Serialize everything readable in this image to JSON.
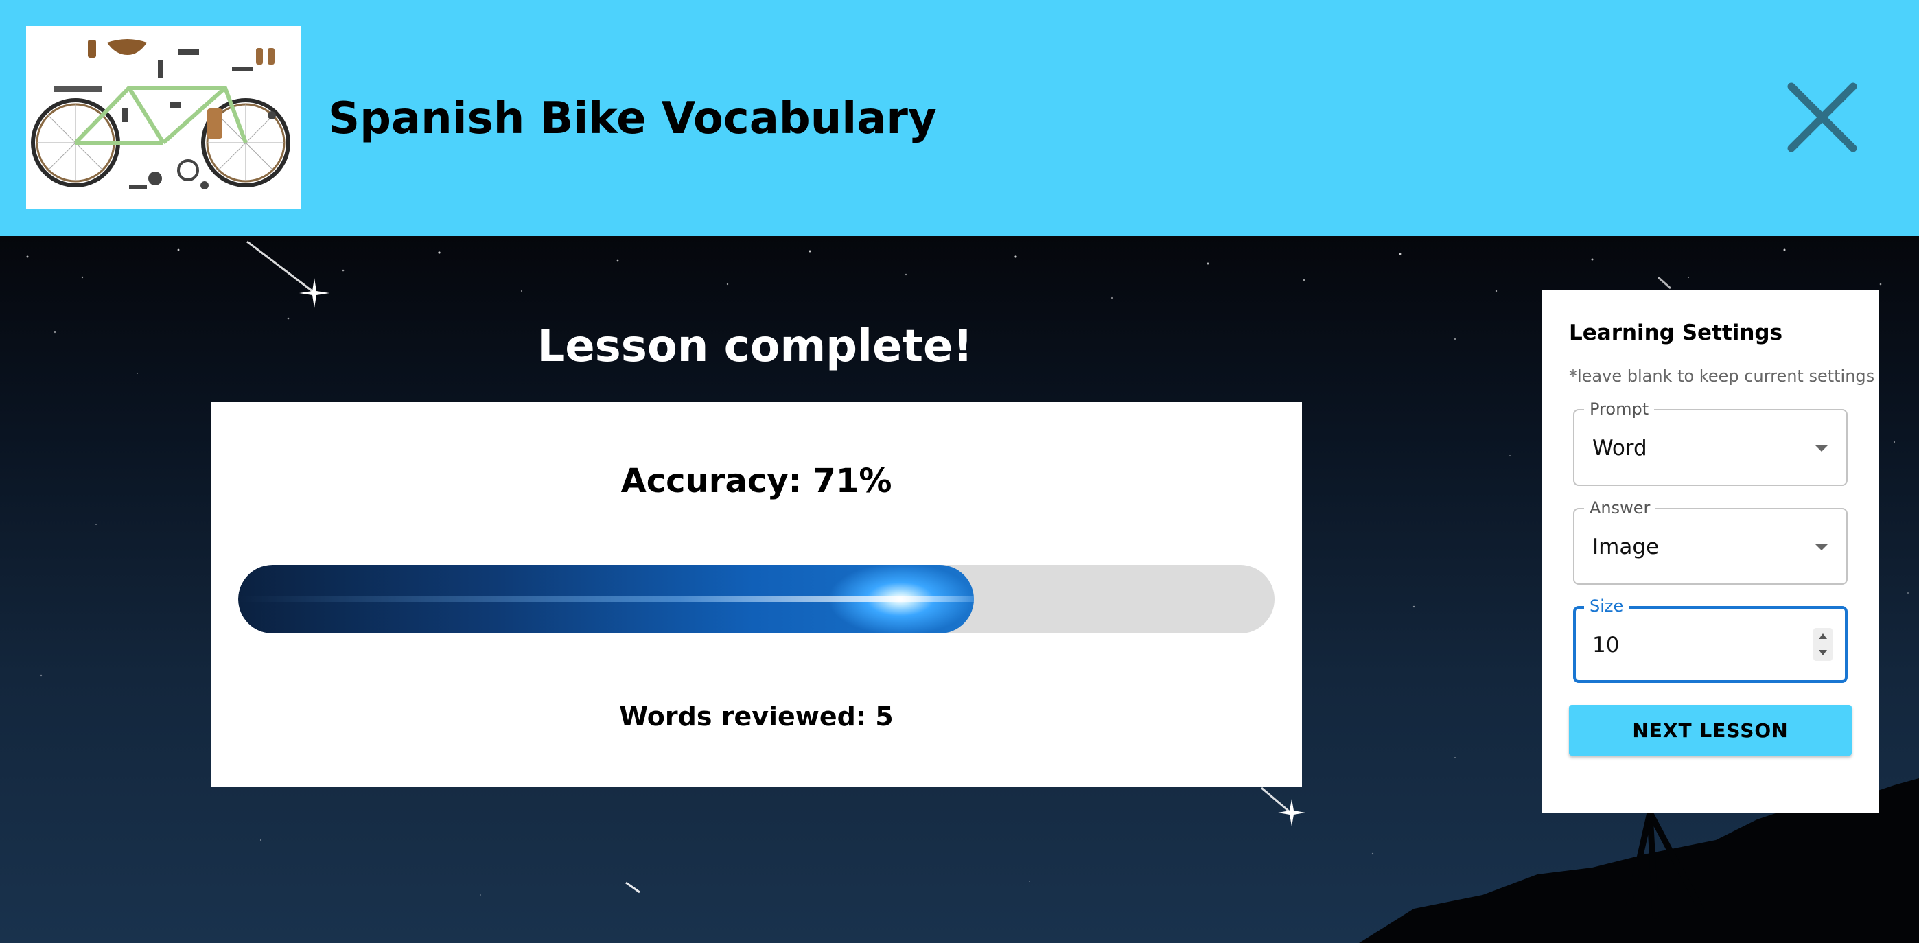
{
  "header": {
    "title": "Spanish Bike Vocabulary",
    "background_color": "#4dd2fc",
    "thumbnail_icon": "bicycle-parts-icon",
    "close_icon": "close-icon"
  },
  "result": {
    "heading": "Lesson complete!",
    "accuracy_text": "Accuracy: 71%",
    "accuracy_percent": 71,
    "words_reviewed_text": "Words reviewed: 5"
  },
  "settings": {
    "title": "Learning Settings",
    "hint": "*leave blank to keep current settings",
    "prompt": {
      "label": "Prompt",
      "value": "Word"
    },
    "answer": {
      "label": "Answer",
      "value": "Image"
    },
    "size": {
      "label": "Size",
      "value": "10"
    },
    "next_button": "NEXT LESSON",
    "focus_color": "#1976d2"
  }
}
